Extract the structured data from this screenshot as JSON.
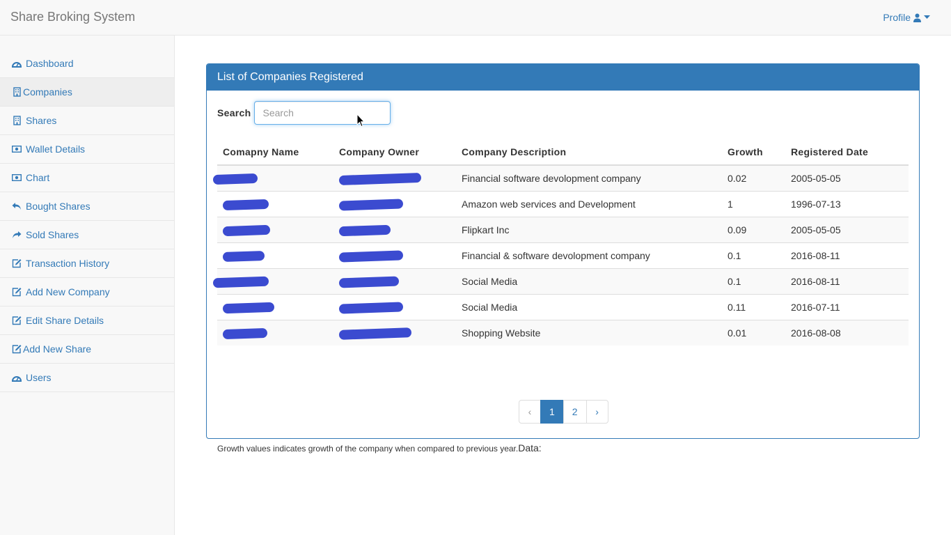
{
  "navbar": {
    "brand": "Share Broking System",
    "profile_label": "Profile"
  },
  "sidebar": {
    "items": [
      {
        "label": "Dashboard",
        "icon": "dashboard-icon"
      },
      {
        "label": "Companies",
        "icon": "building-icon"
      },
      {
        "label": "Shares",
        "icon": "building-icon"
      },
      {
        "label": "Wallet Details",
        "icon": "money-icon"
      },
      {
        "label": "Chart",
        "icon": "money-icon"
      },
      {
        "label": "Bought Shares",
        "icon": "reply-icon"
      },
      {
        "label": "Sold Shares",
        "icon": "share-icon"
      },
      {
        "label": "Transaction History",
        "icon": "edit-icon"
      },
      {
        "label": "Add New Company",
        "icon": "edit-icon"
      },
      {
        "label": "Edit Share Details",
        "icon": "edit-icon"
      },
      {
        "label": "Add New Share",
        "icon": "edit-icon"
      },
      {
        "label": "Users",
        "icon": "dashboard-icon"
      }
    ],
    "active_index": 1
  },
  "panel": {
    "title": "List of Companies Registered",
    "search_label": "Search",
    "search_placeholder": "Search",
    "search_value": ""
  },
  "table": {
    "headers": [
      "Comapny Name",
      "Company Owner",
      "Company Description",
      "Growth",
      "Registered Date"
    ],
    "rows": [
      {
        "description": "Financial software devolopment company",
        "growth": "0.02",
        "date": "2005-05-05"
      },
      {
        "description": "Amazon web services and Development",
        "growth": "1",
        "date": "1996-07-13"
      },
      {
        "description": "Flipkart Inc",
        "growth": "0.09",
        "date": "2005-05-05"
      },
      {
        "description": "Financial & software devolopment company",
        "growth": "0.1",
        "date": "2016-08-11"
      },
      {
        "description": "Social Media",
        "growth": "0.1",
        "date": "2016-08-11"
      },
      {
        "description": "Social Media",
        "growth": "0.11",
        "date": "2016-07-11"
      },
      {
        "description": "Shopping Website",
        "growth": "0.01",
        "date": "2016-08-08"
      }
    ]
  },
  "pagination": {
    "prev": "‹",
    "pages": [
      "1",
      "2"
    ],
    "next": "›",
    "current": "1"
  },
  "footnote": {
    "text": "Growth values indicates growth of the company when compared to previous year.",
    "data_label": "Data:"
  },
  "colors": {
    "primary": "#337ab7",
    "redaction": "#3b4bd0"
  }
}
